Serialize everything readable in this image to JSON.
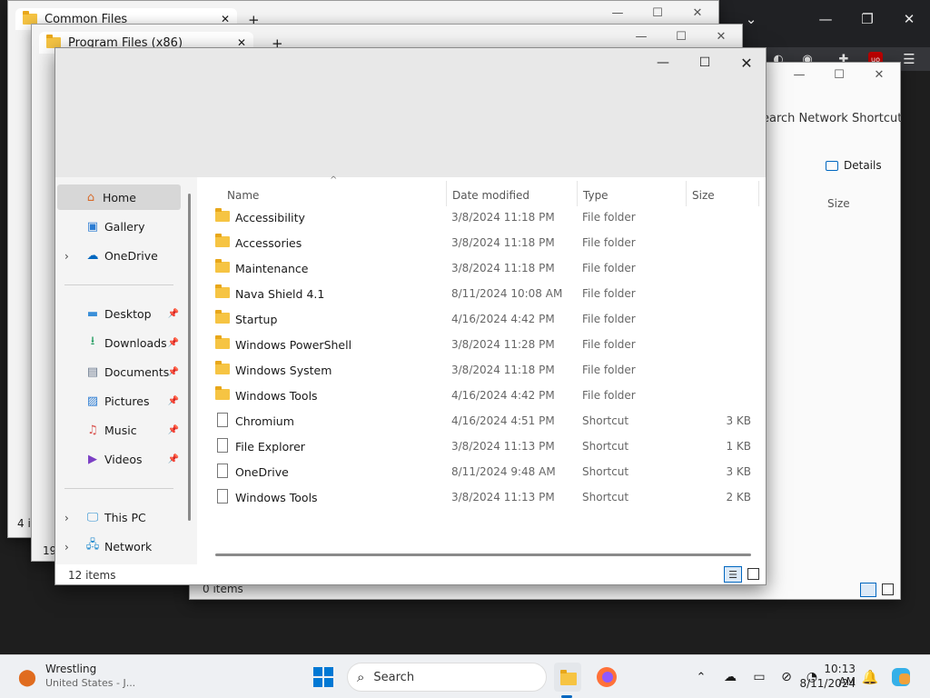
{
  "windows": {
    "back1_tab": "Common Files",
    "back2_tab": "Program Files (x86)",
    "right_search": "earch Network Shortcut",
    "right_details": "Details",
    "right_size_header": "Size",
    "right_status": "0 items",
    "back1_status": "4 i",
    "back2_status": "19"
  },
  "nav": {
    "home": "Home",
    "gallery": "Gallery",
    "onedrive": "OneDrive",
    "desktop": "Desktop",
    "downloads": "Downloads",
    "documents": "Documents",
    "pictures": "Pictures",
    "music": "Music",
    "videos": "Videos",
    "thispc": "This PC",
    "network": "Network"
  },
  "columns": {
    "name": "Name",
    "date": "Date modified",
    "type": "Type",
    "size": "Size"
  },
  "files": [
    {
      "name": "Accessibility",
      "date": "3/8/2024 11:18 PM",
      "type": "File folder",
      "size": "",
      "kind": "folder"
    },
    {
      "name": "Accessories",
      "date": "3/8/2024 11:18 PM",
      "type": "File folder",
      "size": "",
      "kind": "folder"
    },
    {
      "name": "Maintenance",
      "date": "3/8/2024 11:18 PM",
      "type": "File folder",
      "size": "",
      "kind": "folder"
    },
    {
      "name": "Nava Shield 4.1",
      "date": "8/11/2024 10:08 AM",
      "type": "File folder",
      "size": "",
      "kind": "folder"
    },
    {
      "name": "Startup",
      "date": "4/16/2024 4:42 PM",
      "type": "File folder",
      "size": "",
      "kind": "folder"
    },
    {
      "name": "Windows PowerShell",
      "date": "3/8/2024 11:28 PM",
      "type": "File folder",
      "size": "",
      "kind": "folder"
    },
    {
      "name": "Windows System",
      "date": "3/8/2024 11:18 PM",
      "type": "File folder",
      "size": "",
      "kind": "folder"
    },
    {
      "name": "Windows Tools",
      "date": "4/16/2024 4:42 PM",
      "type": "File folder",
      "size": "",
      "kind": "folder"
    },
    {
      "name": "Chromium",
      "date": "4/16/2024 4:51 PM",
      "type": "Shortcut",
      "size": "3 KB",
      "kind": "shortcut"
    },
    {
      "name": "File Explorer",
      "date": "3/8/2024 11:13 PM",
      "type": "Shortcut",
      "size": "1 KB",
      "kind": "shortcut"
    },
    {
      "name": "OneDrive",
      "date": "8/11/2024 9:48 AM",
      "type": "Shortcut",
      "size": "3 KB",
      "kind": "shortcut"
    },
    {
      "name": "Windows Tools",
      "date": "3/8/2024 11:13 PM",
      "type": "Shortcut",
      "size": "2 KB",
      "kind": "shortcut"
    }
  ],
  "status": {
    "count": "12 items"
  },
  "taskbar": {
    "weather_title": "Wrestling",
    "weather_sub": "United States - J...",
    "search_label": "Search",
    "time": "10:13 AM",
    "date": "8/11/2024"
  },
  "colors": {
    "folder": "#f6c443",
    "accent": "#0067c0",
    "selection": "#d7d7d7"
  },
  "icons": [
    "folder-icon",
    "shortcut-icon",
    "home-icon",
    "gallery-icon",
    "cloud-icon",
    "desktop-icon",
    "download-icon",
    "documents-icon",
    "pictures-icon",
    "music-icon",
    "videos-icon",
    "computer-icon",
    "network-icon",
    "pin-icon",
    "windows-start-icon",
    "search-icon",
    "file-explorer-icon",
    "firefox-icon",
    "bell-icon",
    "copilot-icon"
  ]
}
